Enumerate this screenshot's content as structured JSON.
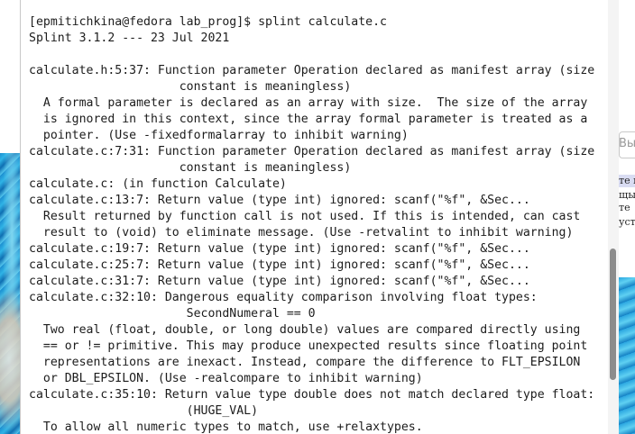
{
  "terminal": {
    "lines": [
      "[epmitichkina@fedora lab_prog]$ splint calculate.c",
      "Splint 3.1.2 --- 23 Jul 2021",
      "",
      "calculate.h:5:37: Function parameter Operation declared as manifest array (size",
      "                     constant is meaningless)",
      "  A formal parameter is declared as an array with size.  The size of the array",
      "  is ignored in this context, since the array formal parameter is treated as a",
      "  pointer. (Use -fixedformalarray to inhibit warning)",
      "calculate.c:7:31: Function parameter Operation declared as manifest array (size",
      "                     constant is meaningless)",
      "calculate.c: (in function Calculate)",
      "calculate.c:13:7: Return value (type int) ignored: scanf(\"%f\", &Sec...",
      "  Result returned by function call is not used. If this is intended, can cast",
      "  result to (void) to eliminate message. (Use -retvalint to inhibit warning)",
      "calculate.c:19:7: Return value (type int) ignored: scanf(\"%f\", &Sec...",
      "calculate.c:25:7: Return value (type int) ignored: scanf(\"%f\", &Sec...",
      "calculate.c:31:7: Return value (type int) ignored: scanf(\"%f\", &Sec...",
      "calculate.c:32:10: Dangerous equality comparison involving float types:",
      "                      SecondNumeral == 0",
      "  Two real (float, double, or long double) values are compared directly using",
      "  == or != primitive. This may produce unexpected results since floating point",
      "  representations are inexact. Instead, compare the difference to FLT_EPSILON",
      "  or DBL_EPSILON. (Use -realcompare to inhibit warning)",
      "calculate.c:35:10: Return value type double does not match declared type float:",
      "                      (HUGE_VAL)",
      "  To allow all numeric types to match, use +relaxtypes."
    ]
  },
  "background_app": {
    "search_placeholder": "Вы",
    "snippets": [
      "те в",
      "щы",
      "те",
      "уст"
    ]
  },
  "colors": {
    "terminal_bg": "#ffffff",
    "terminal_text": "#1c1c1c",
    "scroll_thumb": "#8c8c8c",
    "highlight": "#d9dcf2"
  }
}
